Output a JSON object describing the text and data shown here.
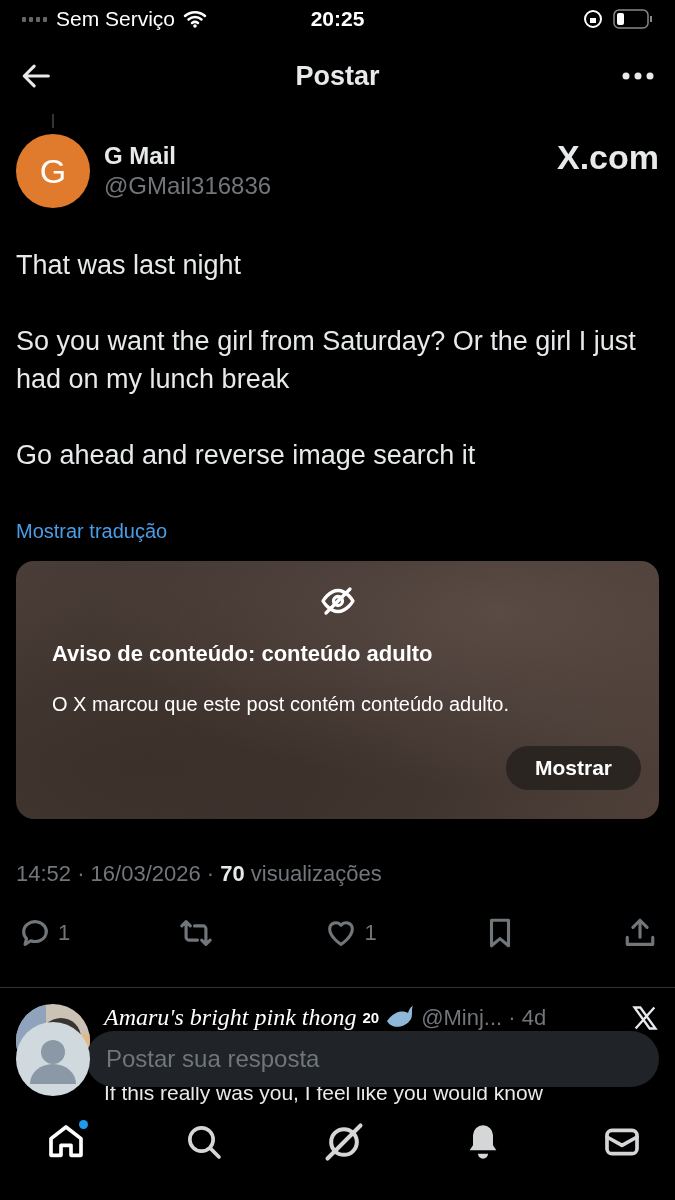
{
  "status_bar": {
    "carrier": "Sem Serviço",
    "time": "20:25"
  },
  "header": {
    "title": "Postar"
  },
  "post": {
    "author": {
      "name": "G Mail",
      "handle": "@GMail316836",
      "initial": "G",
      "color": "#e07b2e"
    },
    "badge": "X.com",
    "paragraphs": [
      "That was last night",
      "So you want the girl from Saturday? Or the girl I just had on my lunch break",
      "Go ahead and reverse image search it"
    ],
    "translate_link": "Mostrar tradução",
    "warning": {
      "title": "Aviso de conteúdo: conteúdo adulto",
      "text": "O X marcou que este post contém conteúdo adulto.",
      "button": "Mostrar"
    },
    "meta": "14:52 · 16/03/2026 · **70** visualizações",
    "actions": [
      {
        "kind": "reply",
        "count": "1"
      },
      {
        "kind": "repost"
      },
      {
        "kind": "like",
        "count": "1"
      },
      {
        "kind": "bookmark"
      },
      {
        "kind": "share"
      }
    ]
  },
  "reply": {
    "name": "Amaru's bright pink thong",
    "sup": "20",
    "handle": "@Minj... · 4d",
    "text": "If this really was you, I feel like you would know"
  },
  "composer": {
    "placeholder": "Postar sua resposta"
  },
  "nav": [
    {
      "kind": "home",
      "selected": true,
      "dot": true
    },
    {
      "kind": "search",
      "selected": false,
      "dot": false
    },
    {
      "kind": "grok",
      "selected": false,
      "dot": false
    },
    {
      "kind": "bell",
      "selected": false,
      "dot": false
    },
    {
      "kind": "mail",
      "selected": false,
      "dot": false
    }
  ]
}
